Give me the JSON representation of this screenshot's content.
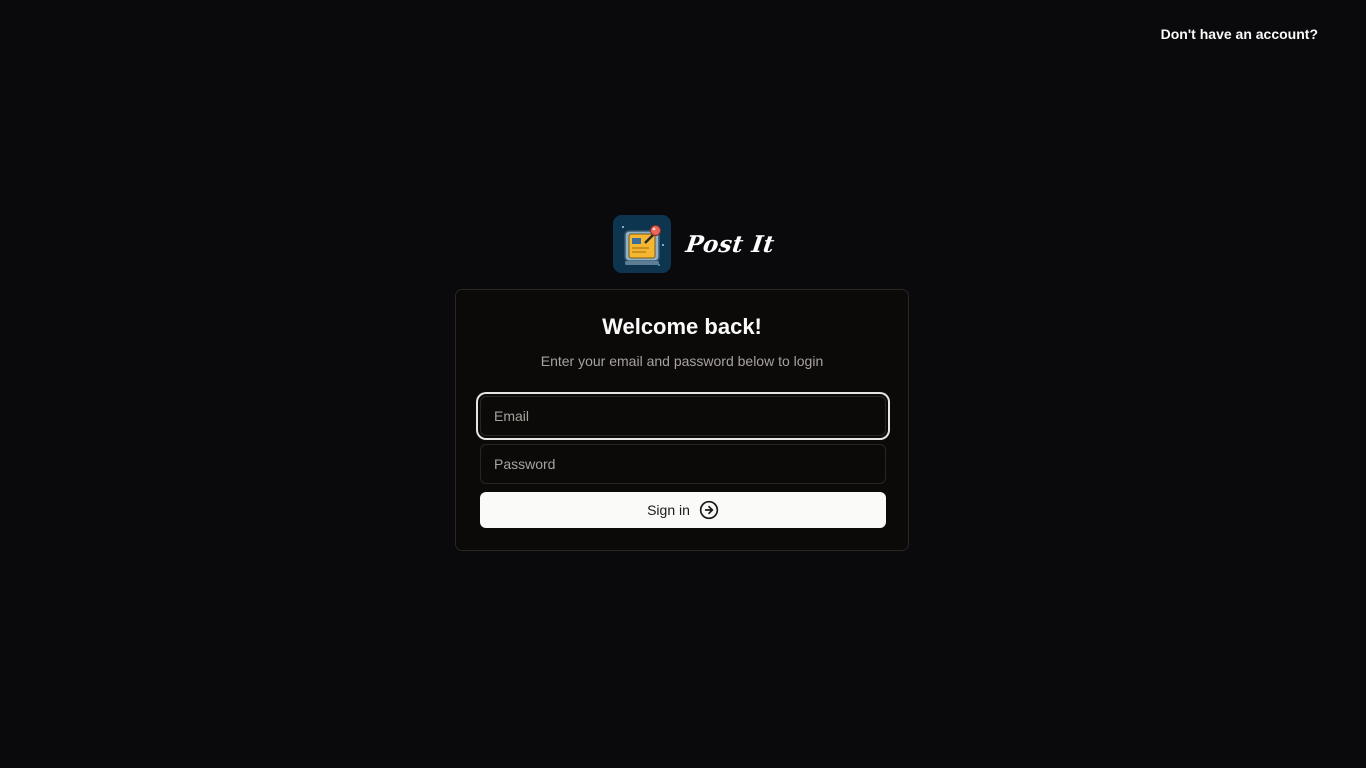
{
  "header": {
    "signup_link": "Don't have an account?"
  },
  "brand": {
    "logo_icon": "sticky-note-logo-icon",
    "name": "Post It"
  },
  "login_card": {
    "title": "Welcome back!",
    "subtitle": "Enter your email and password below to login",
    "email": {
      "placeholder": "Email",
      "value": ""
    },
    "password": {
      "placeholder": "Password",
      "value": ""
    },
    "submit": {
      "label": "Sign in",
      "icon": "arrow-right-circle-icon"
    }
  },
  "colors": {
    "background": "#0a0a0c",
    "card_background": "#0c0a08",
    "card_border": "#2a2826",
    "text_primary": "#fafafa",
    "text_muted": "#a8a29e",
    "button_background": "#fafaf9",
    "button_text": "#1c1917",
    "logo_background": "#0e3550",
    "logo_note": "#f5b731"
  }
}
